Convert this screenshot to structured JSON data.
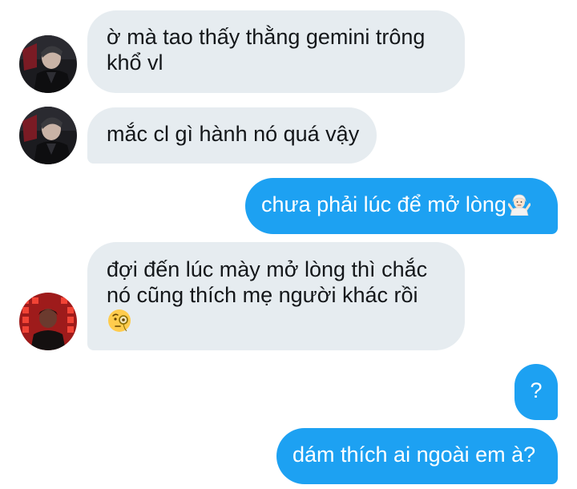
{
  "messages": [
    {
      "side": "incoming",
      "lines": [
        "ờ mà tao thấy thằng gemini trông",
        "khổ vl"
      ]
    },
    {
      "side": "incoming",
      "lines": [
        "mắc cl gì hành nó quá vậy"
      ]
    },
    {
      "side": "outgoing",
      "text": "chưa phải lúc để mở lòng",
      "emoji": "person-shrugging-emoji"
    },
    {
      "side": "incoming",
      "lines": [
        "đợi đến lúc mày mở lòng thì chắc",
        "nó cũng thích mẹ người khác rồi"
      ],
      "emoji": "face-with-monocle-emoji"
    },
    {
      "side": "outgoing",
      "text": "?"
    },
    {
      "side": "outgoing",
      "text": "dám thích ai ngoài em à?"
    }
  ],
  "colors": {
    "incoming_bubble": "#e6ecf0",
    "outgoing_bubble": "#1da1f2",
    "incoming_text": "#14171a",
    "outgoing_text": "#ffffff"
  }
}
